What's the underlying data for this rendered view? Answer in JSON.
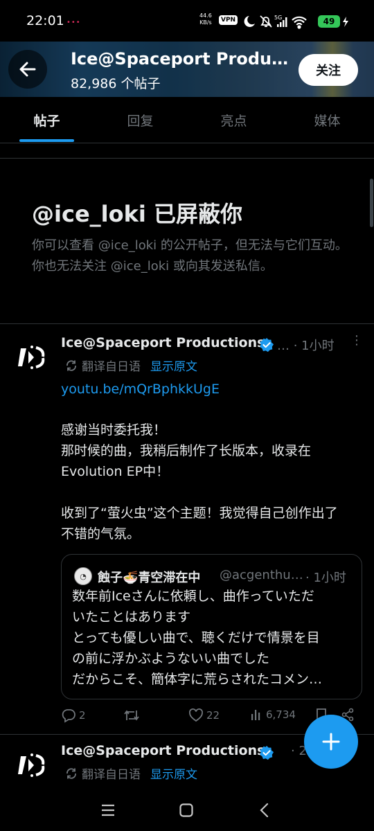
{
  "status_bar": {
    "time": "22:01",
    "dots": "•••",
    "net_speed_value": "44.6",
    "net_speed_unit": "KB/s",
    "vpn": "VPN",
    "network": "5G",
    "battery": "49",
    "icons": [
      "moon-icon",
      "bell-off-icon",
      "signal-icon",
      "wifi-icon",
      "battery-icon",
      "charging-icon"
    ]
  },
  "header": {
    "title": "Ice@Spaceport Productions",
    "posts_count": "82,986 个帖子",
    "follow_label": "关注"
  },
  "tabs": [
    {
      "label": "帖子",
      "active": true
    },
    {
      "label": "回复",
      "active": false
    },
    {
      "label": "亮点",
      "active": false
    },
    {
      "label": "媒体",
      "active": false
    }
  ],
  "blocked": {
    "title": "@ice_loki 已屏蔽你",
    "message": "你可以查看 @ice_loki 的公开帖子，但无法与它们互动。你也无法关注 @ice_loki 或向其发送私信。"
  },
  "post1": {
    "author": "Ice@Spaceport Productions",
    "meta": "… · 1小时",
    "translated_from": "翻译自日语",
    "show_original": "显示原文",
    "link": "youtu.be/mQrBphkkUgE",
    "body_lines": [
      "感谢当时委托我！",
      "那时候的曲，我稍后制作了长版本，收录在",
      "Evolution EP中！",
      "",
      "收到了“萤火虫”这个主题！我觉得自己创作出了",
      "不错的气氛。"
    ],
    "quote": {
      "author": "蝕子🍜青空滞在中",
      "handle": "@acgenthusiast",
      "time": "· 1小时",
      "lines": [
        "数年前Iceさんに依頼し、曲作っていただ",
        "いたことはあります",
        "とっても優しい曲で、聴くだけで情景を目",
        "の前に浮かぶようないい曲でした",
        "だからこそ、簡体字に荒らされたコメン…"
      ]
    },
    "stats": {
      "replies": "2",
      "retweets": "",
      "likes": "22",
      "views": "6,734"
    }
  },
  "post2": {
    "author": "Ice@Spaceport Productions",
    "meta": "· 2",
    "translated_from": "翻译自日语",
    "show_original": "显示原文"
  },
  "colors": {
    "accent": "#1d9bf0",
    "background": "#000000",
    "muted_text": "#71767b",
    "primary_text": "#e7e9ea",
    "border": "#2f3336",
    "battery": "#34c759"
  }
}
